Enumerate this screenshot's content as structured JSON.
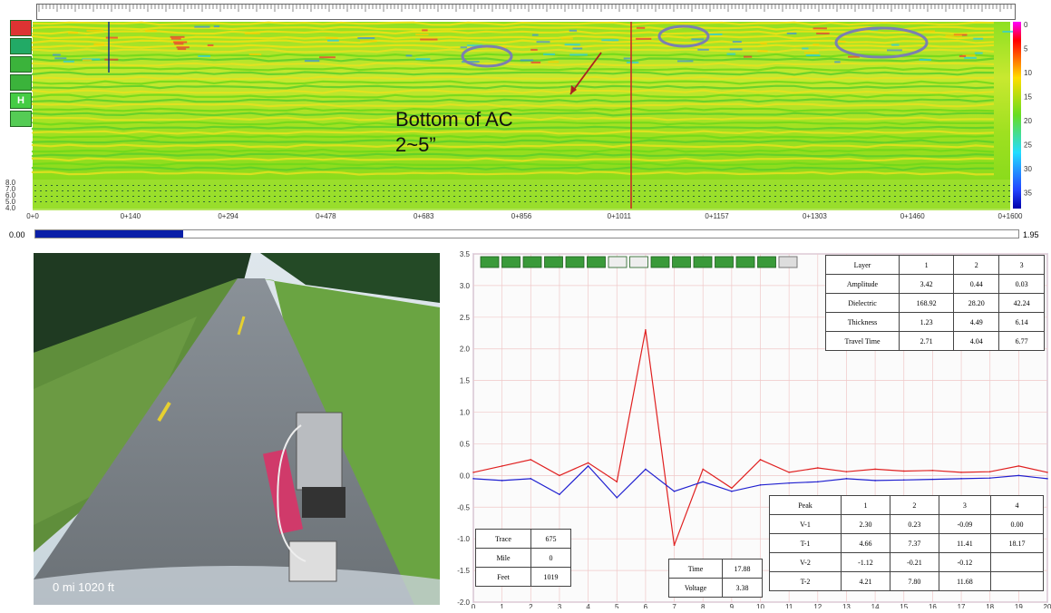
{
  "radar": {
    "annotation_line1": "Bottom of AC",
    "annotation_line2": "2~5”",
    "depth_ticks": [
      "0",
      "5",
      "10",
      "15",
      "20",
      "25",
      "30",
      "35"
    ],
    "left_ticks": [
      "8.0",
      "7.0",
      "6.0",
      "5.0",
      "4.0"
    ],
    "x_ticks": [
      "0+0",
      "0+140",
      "0+294",
      "0+478",
      "0+683",
      "0+856",
      "0+1011",
      "0+1157",
      "0+1303",
      "0+1460",
      "0+1600"
    ],
    "tool_labels": [
      "",
      "",
      "",
      "",
      "H",
      ""
    ],
    "colors": {
      "base": "#7fe01a",
      "band": "#f0e010",
      "marker": "#cc2222",
      "ellipse": "#7b7fb0"
    }
  },
  "progress": {
    "left_label": "0.00",
    "right_label": "1.95",
    "fraction": 0.15
  },
  "photo": {
    "caption": "0 mi  1020 ft"
  },
  "chart_data": {
    "type": "line",
    "x": [
      0,
      1,
      2,
      3,
      4,
      5,
      6,
      7,
      8,
      9,
      10,
      11,
      12,
      13,
      14,
      15,
      16,
      17,
      18,
      19,
      20
    ],
    "ylim": [
      -2.0,
      3.5
    ],
    "xlim": [
      0,
      20
    ],
    "y_ticks": [
      "3.5",
      "3.0",
      "2.5",
      "2.0",
      "1.5",
      "1.0",
      "0.5",
      "0.0",
      "-0.5",
      "-1.0",
      "-1.5",
      "-2.0"
    ],
    "x_ticks": [
      "0",
      "1",
      "2",
      "3",
      "4",
      "5",
      "6",
      "7",
      "8",
      "9",
      "10",
      "11",
      "12",
      "13",
      "14",
      "15",
      "16",
      "17",
      "18",
      "19",
      "20"
    ],
    "series": [
      {
        "color": "#e02020",
        "values": [
          0.05,
          0.15,
          0.25,
          0.0,
          0.2,
          -0.1,
          2.3,
          -1.1,
          0.1,
          -0.2,
          0.25,
          0.05,
          0.12,
          0.06,
          0.1,
          0.07,
          0.08,
          0.05,
          0.06,
          0.15,
          0.05
        ]
      },
      {
        "color": "#2020d0",
        "values": [
          -0.05,
          -0.08,
          -0.05,
          -0.3,
          0.15,
          -0.35,
          0.1,
          -0.25,
          -0.1,
          -0.25,
          -0.15,
          -0.12,
          -0.1,
          -0.05,
          -0.08,
          -0.07,
          -0.06,
          -0.05,
          -0.04,
          0.0,
          -0.05
        ]
      }
    ],
    "grid": true
  },
  "layer_table": {
    "header": [
      "Layer",
      "1",
      "2",
      "3"
    ],
    "rows": [
      [
        "Amplitude",
        "3.42",
        "0.44",
        "0.03"
      ],
      [
        "Dielectric",
        "168.92",
        "28.20",
        "42.24"
      ],
      [
        "Thickness",
        "1.23",
        "4.49",
        "6.14"
      ],
      [
        "Travel Time",
        "2.71",
        "4.04",
        "6.77"
      ]
    ]
  },
  "peak_table": {
    "header": [
      "Peak",
      "1",
      "2",
      "3",
      "4"
    ],
    "rows": [
      [
        "V-1",
        "2.30",
        "0.23",
        "-0.09",
        "0.00"
      ],
      [
        "T-1",
        "4.66",
        "7.37",
        "11.41",
        "18.17"
      ],
      [
        "V-2",
        "-1.12",
        "-0.21",
        "-0.12",
        ""
      ],
      [
        "T-2",
        "4.21",
        "7.80",
        "11.68",
        ""
      ]
    ]
  },
  "trace_table": {
    "rows": [
      [
        "Trace",
        "675"
      ],
      [
        "Mile",
        "0"
      ],
      [
        "Feet",
        "1019"
      ]
    ]
  },
  "time_table": {
    "rows": [
      [
        "Time",
        "17.88"
      ],
      [
        "Voltage",
        "3.38"
      ]
    ]
  }
}
